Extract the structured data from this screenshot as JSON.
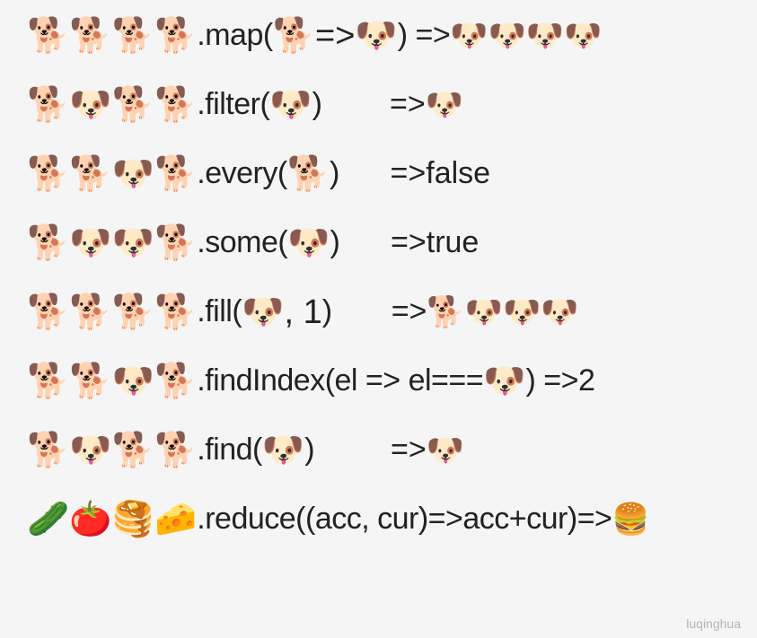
{
  "lines": [
    {
      "array": "🐕🐕🐕🐕",
      "method_start": ".map(",
      "method_inner": "🐕=>🐶",
      "method_end": ") => ",
      "result": "🐶🐶🐶🐶",
      "spacing": ""
    },
    {
      "array": "🐕🐶🐕🐕",
      "method_start": ".filter(",
      "method_inner": "🐶",
      "method_end": ")",
      "spacing": "        ",
      "arrow": "=> ",
      "result": "🐶"
    },
    {
      "array": "🐕🐕🐶🐕",
      "method_start": ".every(",
      "method_inner": "🐕",
      "method_end": ")",
      "spacing": "      ",
      "arrow": "=> ",
      "result": "false"
    },
    {
      "array": "🐕🐶🐶🐕",
      "method_start": ".some(",
      "method_inner": "🐶",
      "method_end": ")",
      "spacing": "      ",
      "arrow": "=> ",
      "result": "true"
    },
    {
      "array": "🐕🐕🐕🐕",
      "method_start": ".fill(",
      "method_inner": "🐶, 1",
      "method_end": ")",
      "spacing": "       ",
      "arrow": "=> ",
      "result": "🐕🐶🐶🐶"
    },
    {
      "array": "🐕🐕🐶🐕",
      "method_start": ".findIndex(el => el===",
      "method_inner": "🐶",
      "method_end": ") => ",
      "spacing": "",
      "arrow": "",
      "result": "2"
    },
    {
      "array": "🐕🐶🐕🐕",
      "method_start": ".find(",
      "method_inner": "🐶",
      "method_end": ")",
      "spacing": "         ",
      "arrow": "=> ",
      "result": "🐶"
    },
    {
      "array": "🥒🍅🥞🧀",
      "method_start": ".reduce((acc, cur)=>acc+cur)=> ",
      "method_inner": "",
      "method_end": "",
      "spacing": "",
      "arrow": "",
      "result": "🍔"
    }
  ],
  "watermark": "luqinghua"
}
